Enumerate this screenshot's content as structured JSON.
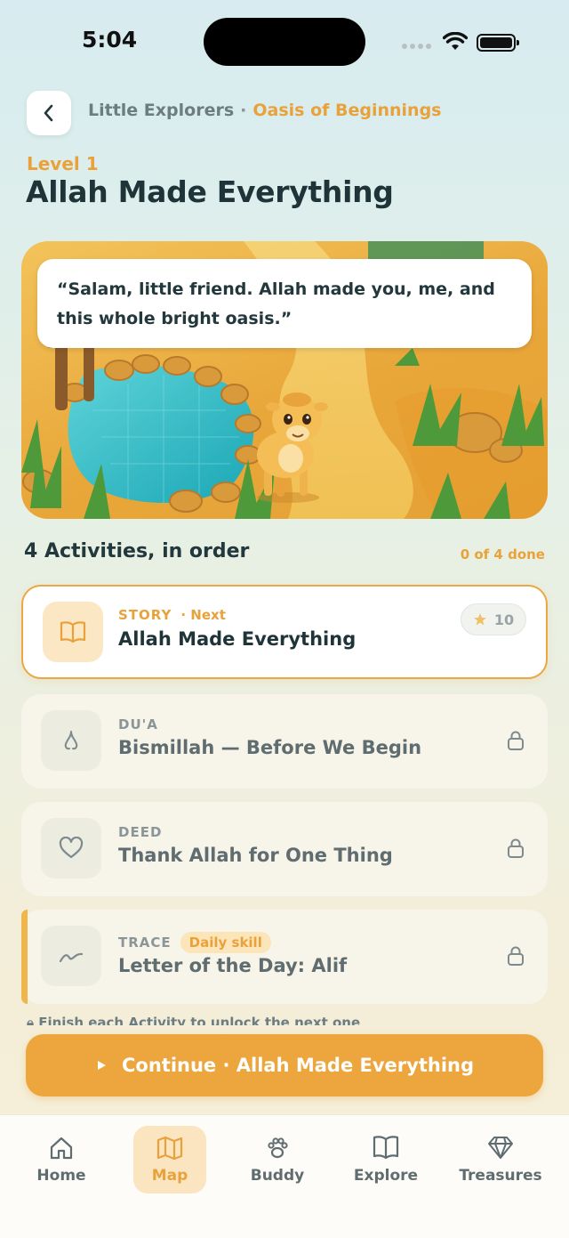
{
  "status_bar": {
    "time": "5:04"
  },
  "header": {
    "breadcrumb_parent": "Little Explorers",
    "breadcrumb_separator": "·",
    "breadcrumb_current": "Oasis of Beginnings",
    "level_label": "Level 1",
    "title": "Allah Made Everything"
  },
  "hero": {
    "speech": "“Salam, little friend. Allah made you, me, and this whole bright oasis.”"
  },
  "activities_section": {
    "title": "4 Activities, in order",
    "progress": "0 of 4 done"
  },
  "activities": [
    {
      "kind": "STORY",
      "tag": "· Next",
      "name": "Allah Made Everything",
      "points": "10",
      "icon": "book-icon"
    },
    {
      "kind": "DU'A",
      "name": "Bismillah — Before We Begin",
      "icon": "drop-icon",
      "locked": true
    },
    {
      "kind": "DEED",
      "name": "Thank Allah for One Thing",
      "icon": "heart-icon",
      "locked": true
    },
    {
      "kind": "TRACE",
      "tag": "Daily skill",
      "name": "Letter of the Day: Alif",
      "icon": "trace-icon",
      "locked": true
    }
  ],
  "hint": "Finish each Activity to unlock the next one",
  "continue_button": {
    "label": "Continue · Allah Made Everything"
  },
  "tab_bar": {
    "items": [
      {
        "label": "Home",
        "icon": "home-icon"
      },
      {
        "label": "Map",
        "icon": "map-icon",
        "active": true
      },
      {
        "label": "Buddy",
        "icon": "paw-icon"
      },
      {
        "label": "Explore",
        "icon": "book-icon"
      },
      {
        "label": "Treasures",
        "icon": "gem-icon"
      }
    ]
  },
  "colors": {
    "accent": "#E9A23B",
    "title": "#1F3438",
    "muted": "#5F6D70"
  }
}
